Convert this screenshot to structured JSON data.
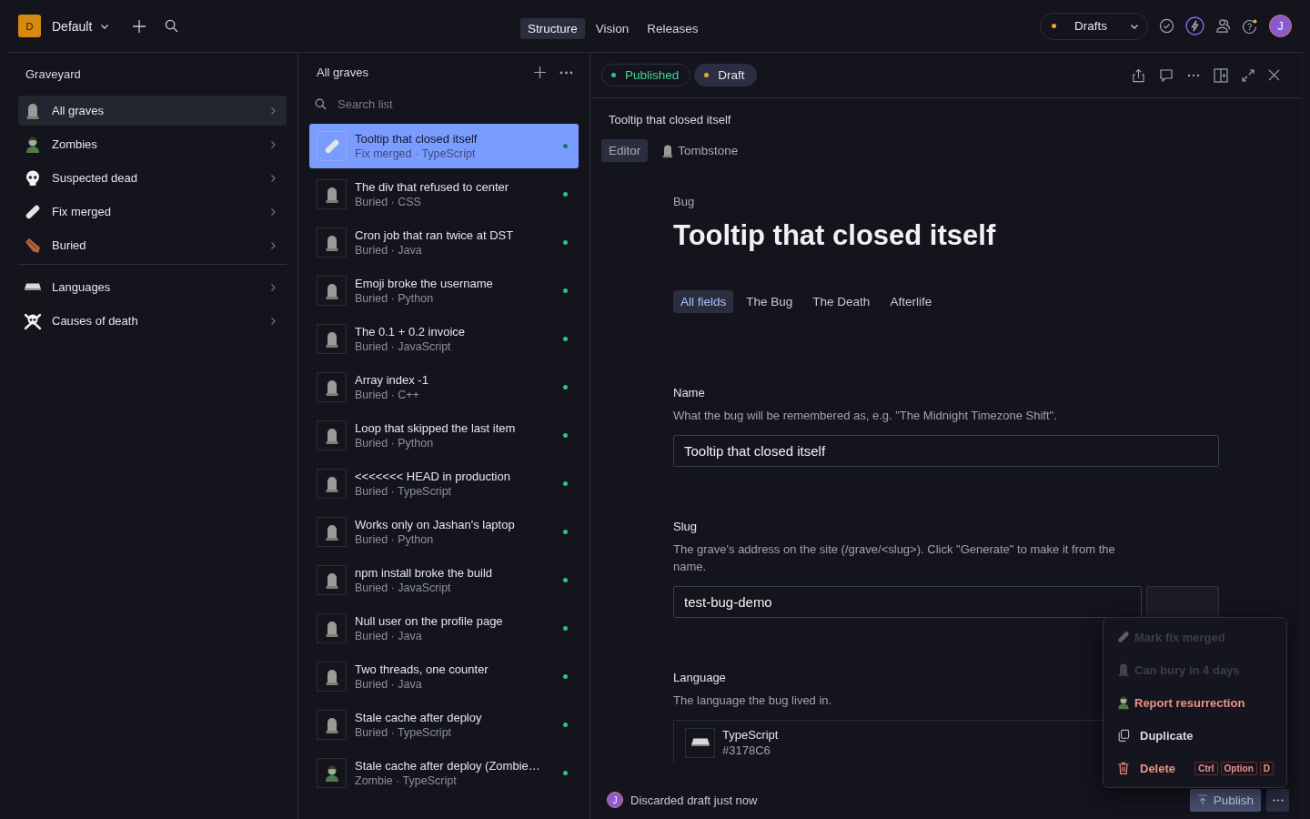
{
  "topbar": {
    "workspace_badge": "D",
    "workspace": "Default",
    "tabs": [
      {
        "label": "Structure",
        "selected": true
      },
      {
        "label": "Vision",
        "selected": false
      },
      {
        "label": "Releases",
        "selected": false
      }
    ],
    "perspective": {
      "label": "Drafts"
    },
    "avatar": "J"
  },
  "sidebar": {
    "title": "Graveyard",
    "groups": [
      [
        {
          "label": "All graves",
          "kind": "tombstone",
          "selected": true
        },
        {
          "label": "Zombies",
          "kind": "zombie",
          "selected": false
        },
        {
          "label": "Suspected dead",
          "kind": "skull",
          "selected": false
        },
        {
          "label": "Fix merged",
          "kind": "bandage",
          "selected": false
        },
        {
          "label": "Buried",
          "kind": "coffin",
          "selected": false
        }
      ],
      [
        {
          "label": "Languages",
          "kind": "keyboard",
          "selected": false
        },
        {
          "label": "Causes of death",
          "kind": "crossbones",
          "selected": false
        }
      ]
    ]
  },
  "list": {
    "title": "All graves",
    "search": {
      "placeholder": "Search list"
    },
    "items": [
      {
        "title": "Tooltip that closed itself",
        "subtitle": "Fix merged · TypeScript",
        "kind": "bandage",
        "selected": true
      },
      {
        "title": "The div that refused to center",
        "subtitle": "Buried · CSS",
        "kind": "tombstone",
        "selected": false
      },
      {
        "title": "Cron job that ran twice at DST",
        "subtitle": "Buried · Java",
        "kind": "tombstone",
        "selected": false
      },
      {
        "title": "Emoji broke the username",
        "subtitle": "Buried · Python",
        "kind": "tombstone",
        "selected": false
      },
      {
        "title": "The 0.1 + 0.2 invoice",
        "subtitle": "Buried · JavaScript",
        "kind": "tombstone",
        "selected": false
      },
      {
        "title": "Array index -1",
        "subtitle": "Buried · C++",
        "kind": "tombstone",
        "selected": false
      },
      {
        "title": "Loop that skipped the last item",
        "subtitle": "Buried · Python",
        "kind": "tombstone",
        "selected": false
      },
      {
        "title": "<<<<<<< HEAD in production",
        "subtitle": "Buried · TypeScript",
        "kind": "tombstone",
        "selected": false
      },
      {
        "title": "Works only on Jashan's laptop",
        "subtitle": "Buried · Python",
        "kind": "tombstone",
        "selected": false
      },
      {
        "title": "npm install broke the build",
        "subtitle": "Buried · JavaScript",
        "kind": "tombstone",
        "selected": false
      },
      {
        "title": "Null user on the profile page",
        "subtitle": "Buried · Java",
        "kind": "tombstone",
        "selected": false
      },
      {
        "title": "Two threads, one counter",
        "subtitle": "Buried · Java",
        "kind": "tombstone",
        "selected": false
      },
      {
        "title": "Stale cache after deploy",
        "subtitle": "Buried · TypeScript",
        "kind": "tombstone",
        "selected": false
      },
      {
        "title": "Stale cache after deploy (Zombie…",
        "subtitle": "Zombie · TypeScript",
        "kind": "zombie",
        "selected": false
      }
    ]
  },
  "document": {
    "versions": [
      {
        "label": "Published",
        "kind": "published",
        "selected": false
      },
      {
        "label": "Draft",
        "kind": "draft",
        "selected": true
      }
    ],
    "title": "Tooltip that closed itself",
    "views": [
      {
        "label": "Editor",
        "kind": "plain",
        "selected": true
      },
      {
        "label": "Tombstone",
        "kind": "tombstone",
        "selected": false
      }
    ],
    "type": "Bug",
    "heading": "Tooltip that closed itself",
    "field_tabs": [
      {
        "label": "All fields",
        "selected": true
      },
      {
        "label": "The Bug",
        "selected": false
      },
      {
        "label": "The Death",
        "selected": false
      },
      {
        "label": "Afterlife",
        "selected": false
      }
    ],
    "fields": [
      {
        "kind": "text",
        "label": "Name",
        "description": "What the bug will be remembered as, e.g. \"The Midnight Timezone Shift\".",
        "value": "Tooltip that closed itself"
      },
      {
        "kind": "slug",
        "label": "Slug",
        "description": "The grave's address on the site (/grave/<slug>). Click \"Generate\" to make it from the name.",
        "value": "test-bug-demo"
      },
      {
        "kind": "reference",
        "label": "Language",
        "description": "The language the bug lived in.",
        "ref_title": "TypeScript",
        "ref_subtitle": "#3178C6"
      }
    ],
    "footer": {
      "avatar": "J",
      "status": "Discarded draft just now",
      "publish": "Publish"
    }
  },
  "menu": {
    "items": [
      {
        "label": "Mark fix merged",
        "kind": "bandage",
        "disabled": true,
        "danger": false
      },
      {
        "label": "Can bury in 4 days",
        "kind": "tombstone",
        "disabled": true,
        "danger": false
      },
      {
        "label": "Report resurrection",
        "kind": "zombie",
        "disabled": false,
        "danger": true
      },
      {
        "label": "Duplicate",
        "kind": "duplicate",
        "disabled": false,
        "danger": false
      },
      {
        "label": "Delete",
        "kind": "trash",
        "disabled": false,
        "danger": true,
        "keys": [
          "Ctrl",
          "Option",
          "D"
        ]
      }
    ]
  }
}
